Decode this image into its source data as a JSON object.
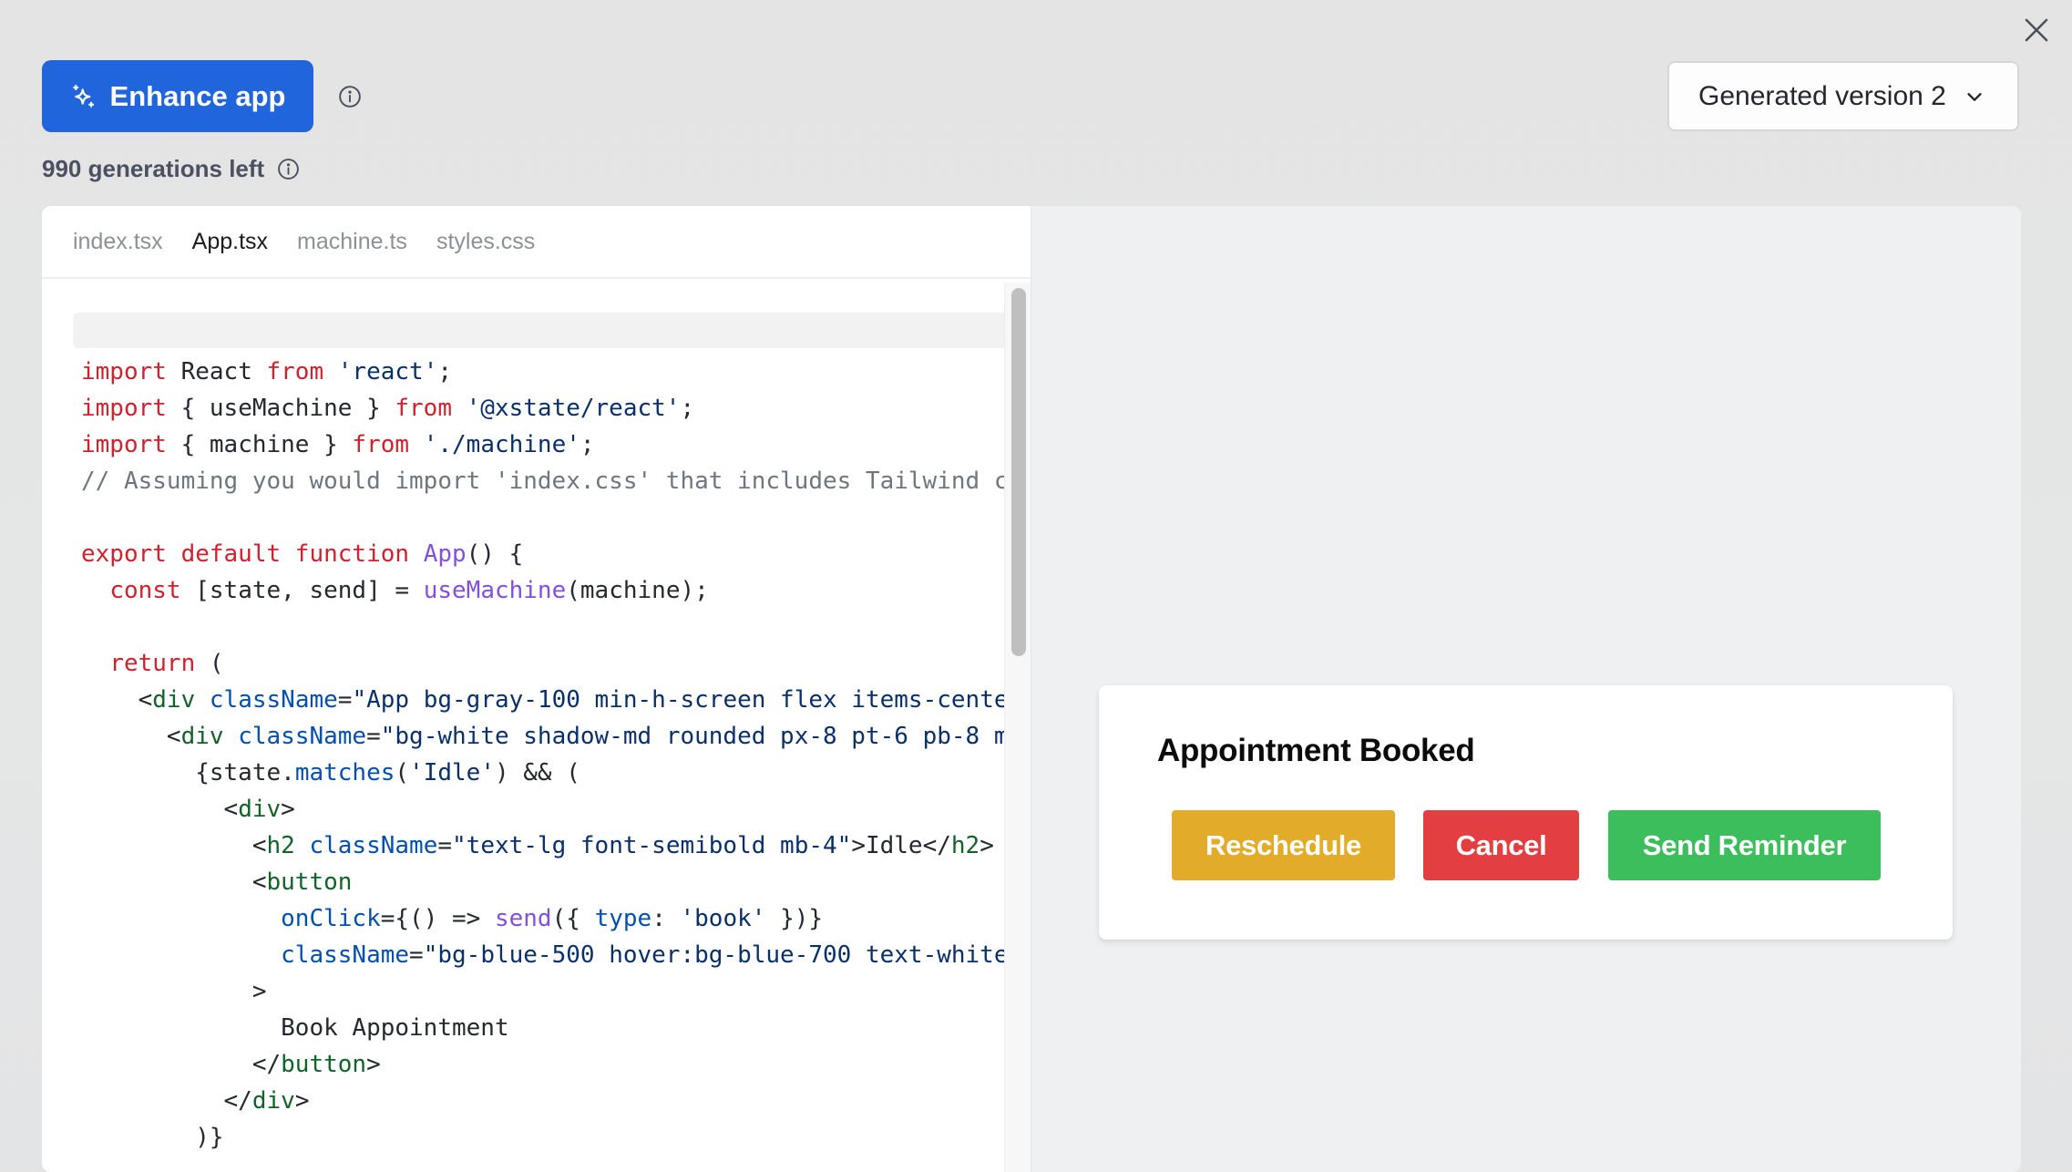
{
  "header": {
    "enhance_label": "Enhance app",
    "generations_left": "990 generations left",
    "version_select": "Generated version 2"
  },
  "icons": {
    "close": "close-icon",
    "sparkles": "sparkles-icon",
    "info": "info-icon",
    "chevron": "chevron-down-icon"
  },
  "editor": {
    "tabs": [
      {
        "label": "index.tsx",
        "active": false
      },
      {
        "label": "App.tsx",
        "active": true
      },
      {
        "label": "machine.ts",
        "active": false
      },
      {
        "label": "styles.css",
        "active": false
      }
    ],
    "code_lines": [
      [
        [
          "k",
          "import"
        ],
        [
          "",
          "  React "
        ],
        [
          "k",
          "from"
        ],
        [
          "s",
          " 'react'"
        ],
        [
          "",
          ";"
        ]
      ],
      [
        [
          "k",
          "import"
        ],
        [
          "",
          " { useMachine } "
        ],
        [
          "k",
          "from"
        ],
        [
          "s",
          " '@xstate/react'"
        ],
        [
          "",
          ";"
        ]
      ],
      [
        [
          "k",
          "import"
        ],
        [
          "",
          " { machine } "
        ],
        [
          "k",
          "from"
        ],
        [
          "s",
          " './machine'"
        ],
        [
          "",
          ";"
        ]
      ],
      [
        [
          "c",
          "// Assuming you would import 'index.css' that includes Tailwind c"
        ]
      ],
      [],
      [
        [
          "k",
          "export default function"
        ],
        [
          "",
          " "
        ],
        [
          "f",
          "App"
        ],
        [
          "",
          "() {"
        ]
      ],
      [
        [
          "",
          "  "
        ],
        [
          "k",
          "const"
        ],
        [
          "",
          " [state, send] = "
        ],
        [
          "f",
          "useMachine"
        ],
        [
          "",
          "(machine);"
        ]
      ],
      [],
      [
        [
          "",
          "  "
        ],
        [
          "k",
          "return"
        ],
        [
          "",
          " ("
        ]
      ],
      [
        [
          "",
          "    <"
        ],
        [
          "t",
          "div"
        ],
        [
          "",
          " "
        ],
        [
          "a",
          "className"
        ],
        [
          "",
          "="
        ],
        [
          "s",
          "\"App bg-gray-100 min-h-screen flex items-cente"
        ]
      ],
      [
        [
          "",
          "      <"
        ],
        [
          "t",
          "div"
        ],
        [
          "",
          " "
        ],
        [
          "a",
          "className"
        ],
        [
          "",
          "="
        ],
        [
          "s",
          "\"bg-white shadow-md rounded px-8 pt-6 pb-8 m"
        ]
      ],
      [
        [
          "",
          "        {state."
        ],
        [
          "a",
          "matches"
        ],
        [
          "",
          "("
        ],
        [
          "s",
          "'Idle'"
        ],
        [
          "",
          ") && ("
        ]
      ],
      [
        [
          "",
          "          <"
        ],
        [
          "t",
          "div"
        ],
        [
          "",
          ">"
        ]
      ],
      [
        [
          "",
          "            <"
        ],
        [
          "t",
          "h2"
        ],
        [
          "",
          " "
        ],
        [
          "a",
          "className"
        ],
        [
          "",
          "="
        ],
        [
          "s",
          "\"text-lg font-semibold mb-4\""
        ],
        [
          "",
          ">Idle</"
        ],
        [
          "t",
          "h2"
        ],
        [
          "",
          ">"
        ]
      ],
      [
        [
          "",
          "            <"
        ],
        [
          "t",
          "button"
        ]
      ],
      [
        [
          "",
          "              "
        ],
        [
          "a",
          "onClick"
        ],
        [
          "",
          "={() => "
        ],
        [
          "f",
          "send"
        ],
        [
          "",
          "({ "
        ],
        [
          "a",
          "type"
        ],
        [
          "",
          ": "
        ],
        [
          "s",
          "'book'"
        ],
        [
          "",
          " })}"
        ]
      ],
      [
        [
          "",
          "              "
        ],
        [
          "a",
          "className"
        ],
        [
          "",
          "="
        ],
        [
          "s",
          "\"bg-blue-500 hover:bg-blue-700 text-white"
        ]
      ],
      [
        [
          "",
          "            >"
        ]
      ],
      [
        [
          "",
          "              Book Appointment"
        ]
      ],
      [
        [
          "",
          "            </"
        ],
        [
          "t",
          "button"
        ],
        [
          "",
          ">"
        ]
      ],
      [
        [
          "",
          "          </"
        ],
        [
          "t",
          "div"
        ],
        [
          "",
          ">"
        ]
      ],
      [
        [
          "",
          "        )}"
        ]
      ]
    ]
  },
  "preview": {
    "title": "Appointment Booked",
    "buttons": {
      "reschedule": "Reschedule",
      "cancel": "Cancel",
      "send_reminder": "Send Reminder"
    },
    "colors": {
      "reschedule": "#e2ab29",
      "cancel": "#e33e41",
      "send_reminder": "#3dbe5c"
    }
  },
  "colors": {
    "accent": "#2165dd"
  }
}
